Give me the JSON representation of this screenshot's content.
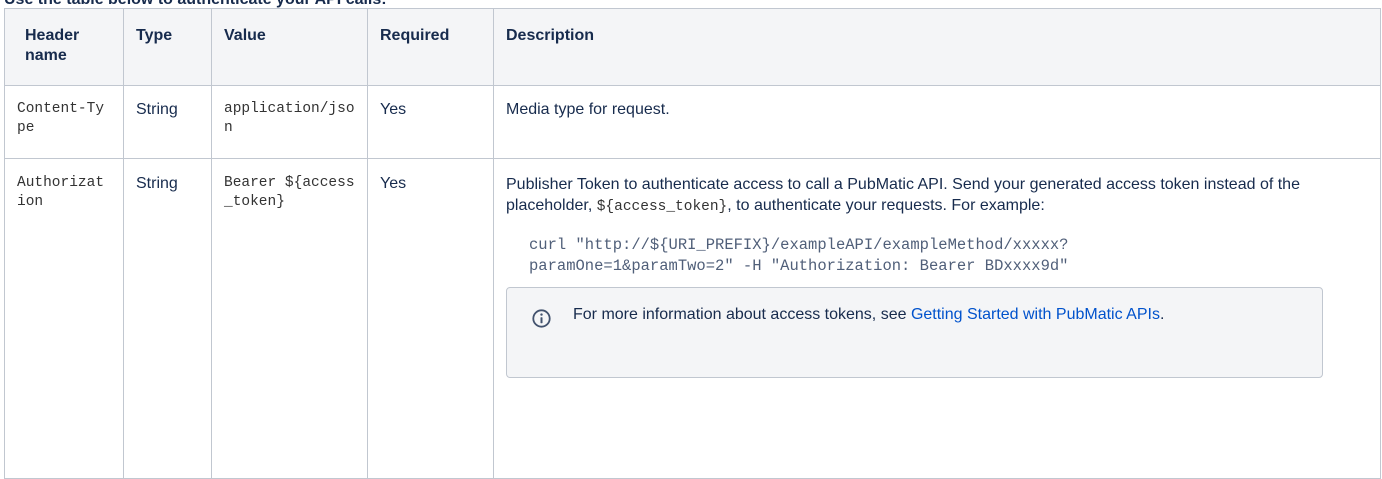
{
  "heading": "Use the table below to authenticate your API calls:",
  "table": {
    "headers": {
      "name": "Header name",
      "type": "Type",
      "value": "Value",
      "required": "Required",
      "description": "Description"
    },
    "rows": [
      {
        "name": "Content-Type",
        "type": "String",
        "value": "application/json",
        "required": "Yes",
        "description": "Media type for request."
      },
      {
        "name": "Authorization",
        "type": "String",
        "value": "Bearer ${access_token}",
        "required": "Yes",
        "description_pre": "Publisher Token to authenticate access to call a PubMatic API. Send your generated access token instead of the placeholder, ",
        "description_code": "${access_token}",
        "description_post": ", to authenticate your requests. For example:",
        "code_line1": "curl \"http://${URI_PREFIX}/exampleAPI/exampleMethod/xxxxx?",
        "code_line2": "paramOne=1&paramTwo=2\" -H \"Authorization: Bearer BDxxxx9d\"",
        "info_text": "For more information about access tokens, see ",
        "info_link": "Getting Started with PubMatic APIs",
        "info_after": ".",
        "info_icon": "info-icon"
      }
    ]
  }
}
